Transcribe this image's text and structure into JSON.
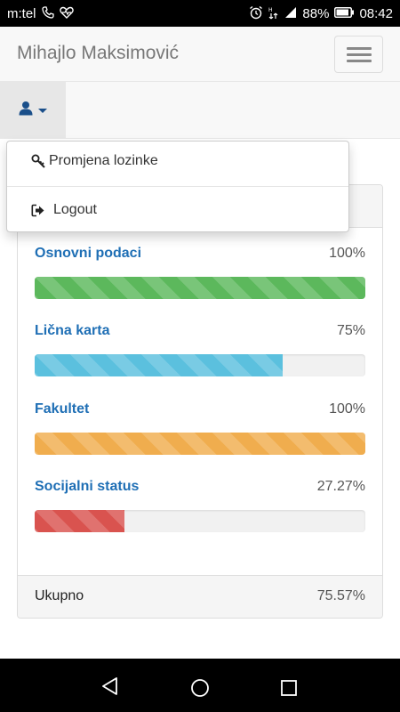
{
  "status_bar": {
    "carrier": "m:tel",
    "battery": "88%",
    "time": "08:42",
    "icons": [
      "phone-icon",
      "heart-rate-icon",
      "alarm-icon",
      "hd-signal-icon",
      "signal-icon",
      "battery-icon"
    ]
  },
  "navbar": {
    "brand": "Mihajlo Maksimović",
    "menu_icon": "hamburger-icon"
  },
  "user_menu": {
    "icon": "user-icon",
    "items": [
      {
        "label": "Promjena lozinke",
        "icon": "key-icon"
      },
      {
        "label": "Logout",
        "icon": "sign-out-icon"
      }
    ]
  },
  "progress": {
    "items": [
      {
        "label": "Osnovni podaci",
        "value": "100%",
        "fraction": 1.0,
        "color": "#5cb85c"
      },
      {
        "label": "Lična karta",
        "value": "75%",
        "fraction": 0.75,
        "color": "#5bc0de"
      },
      {
        "label": "Fakultet",
        "value": "100%",
        "fraction": 1.0,
        "color": "#f0ad4e"
      },
      {
        "label": "Socijalni status",
        "value": "27.27%",
        "fraction": 0.2727,
        "color": "#d9534f"
      }
    ],
    "total_label": "Ukupno",
    "total_value": "75.57%"
  },
  "system_nav": [
    "back-icon",
    "home-icon",
    "recents-icon"
  ]
}
